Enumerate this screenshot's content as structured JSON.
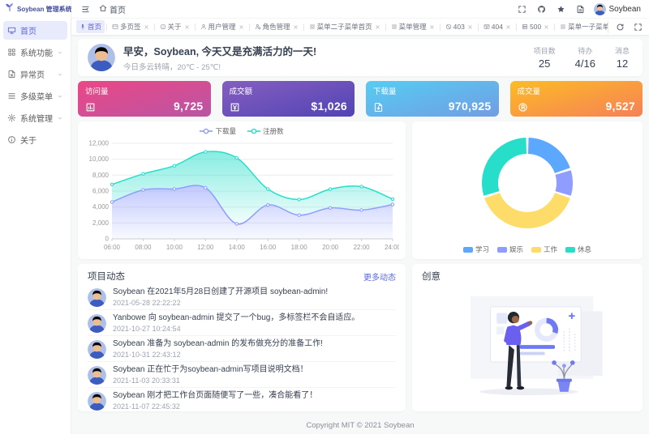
{
  "app": {
    "title": "Soybean 管理系统",
    "username": "Soybean",
    "footer": "Copyright MIT © 2021 Soybean"
  },
  "sidebar": {
    "items": [
      {
        "key": "home",
        "label": "首页",
        "icon": "dashboard-icon",
        "active": true,
        "expandable": false
      },
      {
        "key": "features",
        "label": "系统功能",
        "icon": "grid-icon",
        "active": false,
        "expandable": true
      },
      {
        "key": "exception",
        "label": "异常页",
        "icon": "error-page-icon",
        "active": false,
        "expandable": true
      },
      {
        "key": "multi-menu",
        "label": "多级菜单",
        "icon": "multi-menu-icon",
        "active": false,
        "expandable": true
      },
      {
        "key": "management",
        "label": "系统管理",
        "icon": "settings-icon",
        "active": false,
        "expandable": true
      },
      {
        "key": "about",
        "label": "关于",
        "icon": "about-icon",
        "active": false,
        "expandable": false
      }
    ]
  },
  "header": {
    "breadcrumb": {
      "label": "首页",
      "icon": "home-icon"
    },
    "icons": [
      "fullscreen-icon",
      "github-icon",
      "theme-icon",
      "docs-icon"
    ]
  },
  "tabs": {
    "items": [
      {
        "key": "home",
        "label": "首页",
        "icon": "pin-icon",
        "active": true,
        "closable": false
      },
      {
        "key": "multi-tab",
        "label": "多页签",
        "icon": "window-icon",
        "active": false,
        "closable": true
      },
      {
        "key": "about",
        "label": "关于",
        "icon": "info-icon",
        "active": false,
        "closable": true
      },
      {
        "key": "user-manage",
        "label": "用户管理",
        "icon": "user-icon",
        "active": false,
        "closable": true
      },
      {
        "key": "role-manage",
        "label": "角色管理",
        "icon": "role-icon",
        "active": false,
        "closable": true
      },
      {
        "key": "menu2-sub-home",
        "label": "菜单二子菜单首页",
        "icon": "menu-icon",
        "active": false,
        "closable": true
      },
      {
        "key": "menu-manage",
        "label": "菜单管理",
        "icon": "menu-icon",
        "active": false,
        "closable": true
      },
      {
        "key": "403",
        "label": "403",
        "icon": "forbidden-icon",
        "active": false,
        "closable": true
      },
      {
        "key": "404",
        "label": "404",
        "icon": "not-found-icon",
        "active": false,
        "closable": true
      },
      {
        "key": "500",
        "label": "500",
        "icon": "server-error-icon",
        "active": false,
        "closable": true
      },
      {
        "key": "menu1-sub",
        "label": "菜单一子菜单",
        "icon": "menu-icon",
        "active": false,
        "closable": true
      }
    ]
  },
  "greeting": {
    "title": "早安，Soybean, 今天又是充满活力的一天!",
    "subtitle": "今日多云转晴，20℃ - 25℃!"
  },
  "overview_stats": [
    {
      "key": "projects",
      "label": "项目数",
      "value": "25"
    },
    {
      "key": "todos",
      "label": "待办",
      "value": "4/16"
    },
    {
      "key": "messages",
      "label": "消息",
      "value": "12"
    }
  ],
  "stat_cards": [
    {
      "key": "visits",
      "label": "访问量",
      "value": "9,725",
      "icon": "bar-chart-icon",
      "gradient": [
        "#ec4786",
        "#b955a4"
      ]
    },
    {
      "key": "turnover",
      "label": "成交额",
      "value": "$1,026",
      "icon": "yuan-icon",
      "gradient": [
        "#865ec0",
        "#5144b4"
      ]
    },
    {
      "key": "downloads",
      "label": "下载量",
      "value": "970,925",
      "icon": "download-icon",
      "gradient": [
        "#56cdf3",
        "#719de3"
      ]
    },
    {
      "key": "deals",
      "label": "成交量",
      "value": "9,527",
      "icon": "trademark-icon",
      "gradient": [
        "#fcbc25",
        "#f68057"
      ]
    }
  ],
  "chart_data": [
    {
      "type": "area",
      "stacked": true,
      "grid": true,
      "legend_position": "top",
      "x": [
        "06:00",
        "08:00",
        "10:00",
        "12:00",
        "14:00",
        "16:00",
        "18:00",
        "20:00",
        "22:00",
        "24:00"
      ],
      "series": [
        {
          "key": "downloads",
          "name": "下载量",
          "color": "#8e9dff",
          "values": [
            4623,
            6145,
            6268,
            6411,
            1890,
            4251,
            2978,
            3880,
            3606,
            4311
          ]
        },
        {
          "key": "registrations",
          "name": "注册数",
          "color": "#26deca",
          "values": [
            2208,
            2016,
            2916,
            4512,
            8281,
            2008,
            1963,
            2367,
            2956,
            678
          ]
        }
      ],
      "ylim": [
        0,
        12000
      ],
      "y_tick_step": 2000
    },
    {
      "type": "pie",
      "donut": true,
      "legend_position": "bottom",
      "items": [
        {
          "key": "study",
          "name": "学习",
          "value": 20,
          "color": "#5da8ff"
        },
        {
          "key": "entertainment",
          "name": "娱乐",
          "value": 10,
          "color": "#8e9dff"
        },
        {
          "key": "work",
          "name": "工作",
          "value": 40,
          "color": "#fedc69"
        },
        {
          "key": "rest",
          "name": "休息",
          "value": 30,
          "color": "#26deca"
        }
      ]
    }
  ],
  "news": {
    "title": "项目动态",
    "more_label": "更多动态",
    "items": [
      {
        "text": "Soybean 在2021年5月28日创建了开源项目 soybean-admin!",
        "time": "2021-05-28 22:22:22"
      },
      {
        "text": "Yanbowe 向 soybean-admin 提交了一个bug，多标签栏不会自适应。",
        "time": "2021-10-27 10:24:54"
      },
      {
        "text": "Soybean 准备为 soybean-admin 的发布做充分的准备工作!",
        "time": "2021-10-31 22:43:12"
      },
      {
        "text": "Soybean 正在忙于为soybean-admin写项目说明文档！",
        "time": "2021-11-03 20:33:31"
      },
      {
        "text": "Soybean 刚才把工作台页面随便写了一些，凑合能看了！",
        "time": "2021-11-07 22:45:32"
      }
    ]
  },
  "creativity": {
    "title": "创意"
  }
}
